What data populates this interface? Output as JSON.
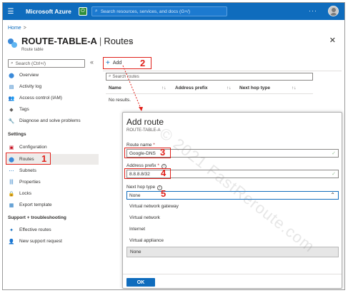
{
  "topbar": {
    "brand": "Microsoft Azure",
    "search_placeholder": "Search resources, services, and docs (G+/)",
    "more": "···"
  },
  "breadcrumb": {
    "home": "Home",
    "sep": ">"
  },
  "header": {
    "title": "ROUTE-TABLE-A",
    "divider": "|",
    "section": "Routes",
    "subtitle": "Route table"
  },
  "nav": {
    "search_placeholder": "Search (Ctrl+/)",
    "collapse": "«",
    "items_top": [
      "Overview",
      "Activity log",
      "Access control (IAM)",
      "Tags",
      "Diagnose and solve problems"
    ],
    "settings_header": "Settings",
    "settings_items": [
      "Configuration",
      "Routes",
      "Subnets",
      "Properties",
      "Locks",
      "Export template"
    ],
    "support_header": "Support + troubleshooting",
    "support_items": [
      "Effective routes",
      "New support request"
    ]
  },
  "toolbar": {
    "add_label": "Add"
  },
  "table": {
    "filter_placeholder": "Search routes",
    "columns": [
      "Name",
      "Address prefix",
      "Next hop type"
    ],
    "empty": "No results."
  },
  "dialog": {
    "title": "Add route",
    "subtitle": "ROUTE-TABLE-A",
    "route_name_label": "Route name",
    "route_name_value": "Google-DNS",
    "prefix_label": "Address prefix",
    "prefix_value": "8.8.8.8/32",
    "next_hop_label": "Next hop type",
    "next_hop_value": "None",
    "next_hop_options": [
      "Virtual network gateway",
      "Virtual network",
      "Internet",
      "Virtual appliance",
      "None"
    ],
    "required_mark": "*",
    "info_mark": "i",
    "ok_label": "OK"
  },
  "annotations": [
    "1",
    "2",
    "3",
    "4",
    "5"
  ],
  "watermark": "© 2021 FastReroute.com",
  "colors": {
    "azure_blue": "#0f6cbd",
    "annotation_red": "#e0201a"
  }
}
